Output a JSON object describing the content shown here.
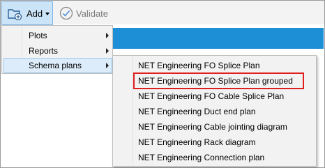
{
  "toolbar": {
    "add_label": "Add",
    "validate_label": "Validate"
  },
  "menu": {
    "items": [
      {
        "label": "Plots"
      },
      {
        "label": "Reports"
      },
      {
        "label": "Schema plans"
      }
    ]
  },
  "submenu": {
    "items": [
      {
        "label": "NET Engineering FO Splice Plan"
      },
      {
        "label": "NET Engineering FO Splice Plan grouped"
      },
      {
        "label": "NET Engineering FO Cable Splice Plan"
      },
      {
        "label": "NET Engineering Duct end plan"
      },
      {
        "label": "NET Engineering Cable jointing diagram"
      },
      {
        "label": "NET Engineering Rack diagram"
      },
      {
        "label": "NET Engineering Connection plan"
      }
    ]
  },
  "colors": {
    "accent_strip": "#1d8fd6",
    "highlight_border": "#e01e1e",
    "active_item_bg": "#dcecfa"
  },
  "icons": {
    "add": "folder-add-icon",
    "validate": "check-circle-icon",
    "submenu_arrow": "chevron-right-icon",
    "dropdown": "caret-down-icon"
  }
}
